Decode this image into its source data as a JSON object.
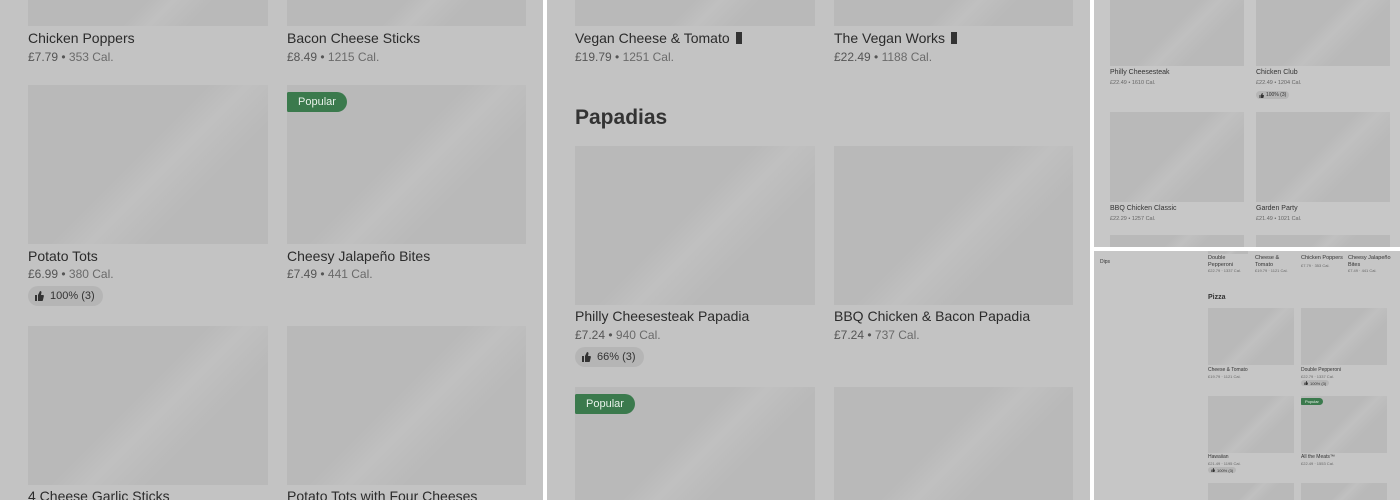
{
  "panel1": {
    "items": [
      {
        "name": "Chicken Poppers",
        "price": "£7.79",
        "cal": "353 Cal."
      },
      {
        "name": "Bacon Cheese Sticks",
        "price": "£8.49",
        "cal": "1215 Cal."
      },
      {
        "name": "Potato Tots",
        "price": "£6.99",
        "cal": "380 Cal.",
        "rating": "100% (3)"
      },
      {
        "name": "Cheesy Jalapeño Bites",
        "price": "£7.49",
        "cal": "441 Cal.",
        "badge": "Popular"
      },
      {
        "name": "4 Cheese Garlic Sticks"
      },
      {
        "name": "Potato Tots with Four Cheeses"
      }
    ]
  },
  "panel2": {
    "section_heading": "Papadias",
    "items": [
      {
        "name": "Vegan Cheese & Tomato",
        "price": "£19.79",
        "cal": "1251 Cal."
      },
      {
        "name": "The Vegan Works",
        "price": "£22.49",
        "cal": "1188 Cal."
      },
      {
        "name": "Philly Cheesesteak Papadia",
        "price": "£7.24",
        "cal": "940 Cal.",
        "rating": "66% (3)"
      },
      {
        "name": "BBQ Chicken & Bacon Papadia",
        "price": "£7.24",
        "cal": "737 Cal."
      },
      {
        "badge": "Popular"
      }
    ]
  },
  "panel3": {
    "items": [
      {
        "name": "Philly Cheesesteak",
        "price": "£22.49",
        "cal": "1610 Cal."
      },
      {
        "name": "Chicken Club",
        "price": "£22.49",
        "cal": "1204 Cal.",
        "rating": "100% (3)"
      },
      {
        "name": "BBQ Chicken Classic",
        "price": "£22.29",
        "cal": "1257 Cal."
      },
      {
        "name": "Garden Party",
        "price": "£21.49",
        "cal": "1021 Cal."
      }
    ]
  },
  "panel4": {
    "side_label": "Dips",
    "top_items": [
      {
        "name": "Double Pepperoni",
        "meta": "£22.79 · 1337 Cal."
      },
      {
        "name": "Cheese & Tomato",
        "meta": "£19.79 · 1121 Cal."
      },
      {
        "name": "Chicken Poppers",
        "meta": "£7.79 · 353 Cal."
      },
      {
        "name": "Cheesy Jalapeño Bites",
        "meta": "£7.49 · 441 Cal."
      }
    ],
    "section_heading": "Pizza",
    "items": [
      {
        "name": "Cheese & Tomato",
        "meta": "£19.79 · 1121 Cal."
      },
      {
        "name": "Double Pepperoni",
        "meta": "£22.79 · 1337 Cal.",
        "rating": "100% (3)"
      },
      {
        "name": "Hawaiian",
        "meta": "£21.49 · 1195 Cal.",
        "rating": "100% (3)"
      },
      {
        "name": "All the Meats™",
        "meta": "£22.49 · 1553 Cal.",
        "badge": "Popular"
      }
    ]
  },
  "colors": {
    "badge_green": "#3b7a4d",
    "panel_bg": "#c3c3c3",
    "image_placeholder": "#b9b9b9"
  }
}
